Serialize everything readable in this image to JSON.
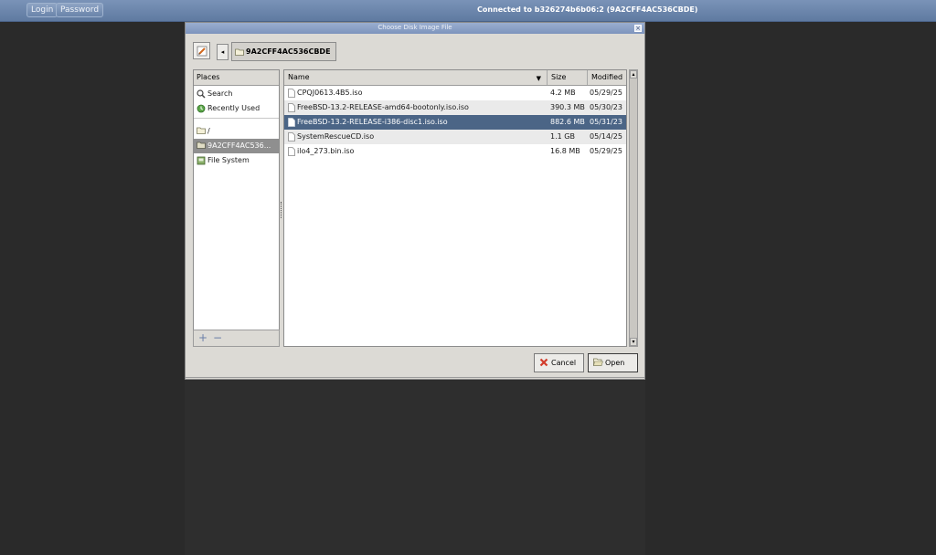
{
  "topbar": {
    "login_label": "Login",
    "password_label": "Password",
    "status": "Connected to b326274b6b06:2 (9A2CFF4AC536CBDE)"
  },
  "dialog": {
    "title": "Choose Disk Image File",
    "close_glyph": "×",
    "back_glyph": "◂",
    "path_button": "9A2CFF4AC536CBDE",
    "places": {
      "header": "Places",
      "items": [
        {
          "label": "Search",
          "icon": "search-icon"
        },
        {
          "label": "Recently Used",
          "icon": "recent-icon"
        },
        {
          "label": "/",
          "icon": "folder-icon"
        },
        {
          "label": "9A2CFF4AC536...",
          "icon": "folder-icon"
        },
        {
          "label": "File System",
          "icon": "drive-icon"
        }
      ],
      "add_glyph": "+",
      "remove_glyph": "−"
    },
    "files": {
      "columns": {
        "name": "Name",
        "size": "Size",
        "modified": "Modified"
      },
      "sort_glyph": "▼",
      "rows": [
        {
          "name": "CPQJ0613.4B5.iso",
          "size": "4.2 MB",
          "modified": "05/29/25"
        },
        {
          "name": "FreeBSD-13.2-RELEASE-amd64-bootonly.iso.iso",
          "size": "390.3 MB",
          "modified": "05/30/23"
        },
        {
          "name": "FreeBSD-13.2-RELEASE-i386-disc1.iso.iso",
          "size": "882.6 MB",
          "modified": "05/31/23"
        },
        {
          "name": "SystemRescueCD.iso",
          "size": "1.1 GB",
          "modified": "05/14/25"
        },
        {
          "name": "ilo4_273.bin.iso",
          "size": "16.8 MB",
          "modified": "05/29/25"
        }
      ],
      "selected_index": 2
    },
    "scroll": {
      "up_glyph": "▴",
      "down_glyph": "▾"
    },
    "buttons": {
      "cancel": "Cancel",
      "open": "Open"
    },
    "colors": {
      "selection": "#4b6586",
      "titlebar": "#8aa0c6"
    }
  }
}
